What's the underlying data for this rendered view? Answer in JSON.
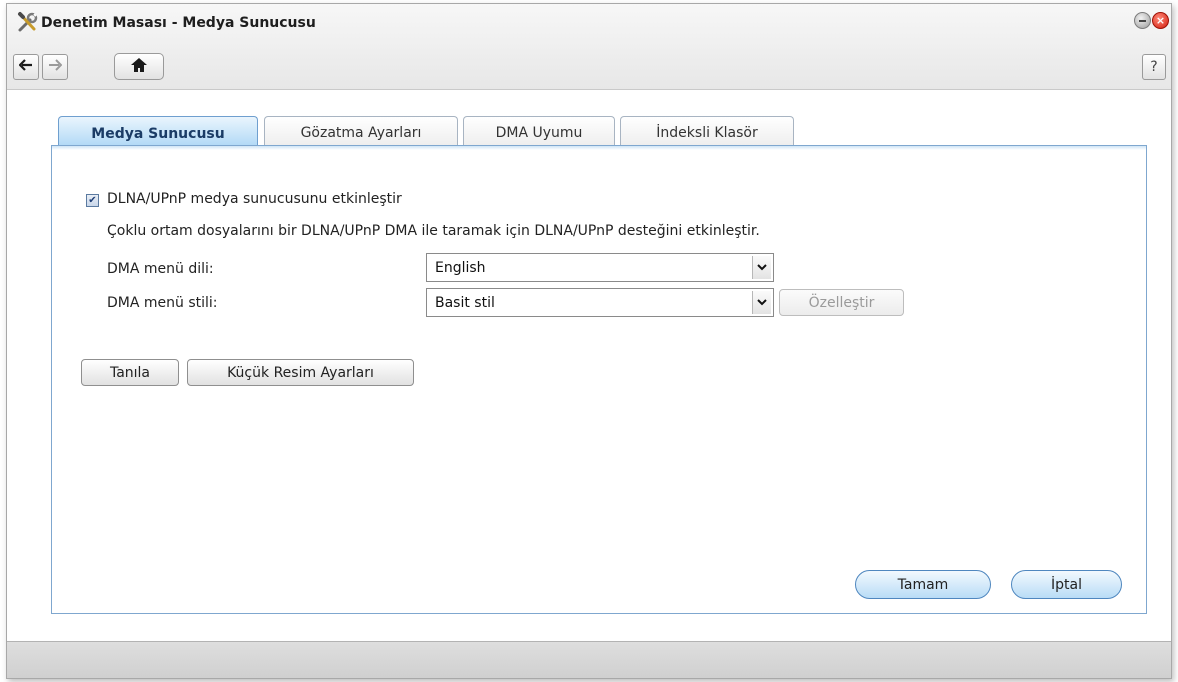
{
  "window": {
    "title": "Denetim Masası - Medya Sunucusu",
    "title_icon": "wrench-screwdriver-icon",
    "help_label": "?"
  },
  "tabs": [
    {
      "label": "Medya Sunucusu",
      "active": true
    },
    {
      "label": "Gözatma Ayarları",
      "active": false
    },
    {
      "label": "DMA Uyumu",
      "active": false
    },
    {
      "label": "İndeksli Klasör",
      "active": false
    }
  ],
  "media_server": {
    "enable_checkbox_label": "DLNA/UPnP medya sunucusunu etkinleştir",
    "enable_checked": true,
    "description": "Çoklu ortam dosyalarını bir DLNA/UPnP DMA ile taramak için DLNA/UPnP desteğini etkinleştir.",
    "menu_language_label": "DMA menü dili:",
    "menu_language_value": "English",
    "menu_style_label": "DMA menü stili:",
    "menu_style_value": "Basit stil",
    "customize_label": "Özelleştir",
    "identify_label": "Tanıla",
    "thumbnail_settings_label": "Küçük Resim Ayarları"
  },
  "footer": {
    "ok_label": "Tamam",
    "cancel_label": "İptal"
  },
  "colors": {
    "active_tab": "#a9d5f5",
    "panel_border": "#7fa7cf",
    "close_button": "#d21c0c"
  }
}
